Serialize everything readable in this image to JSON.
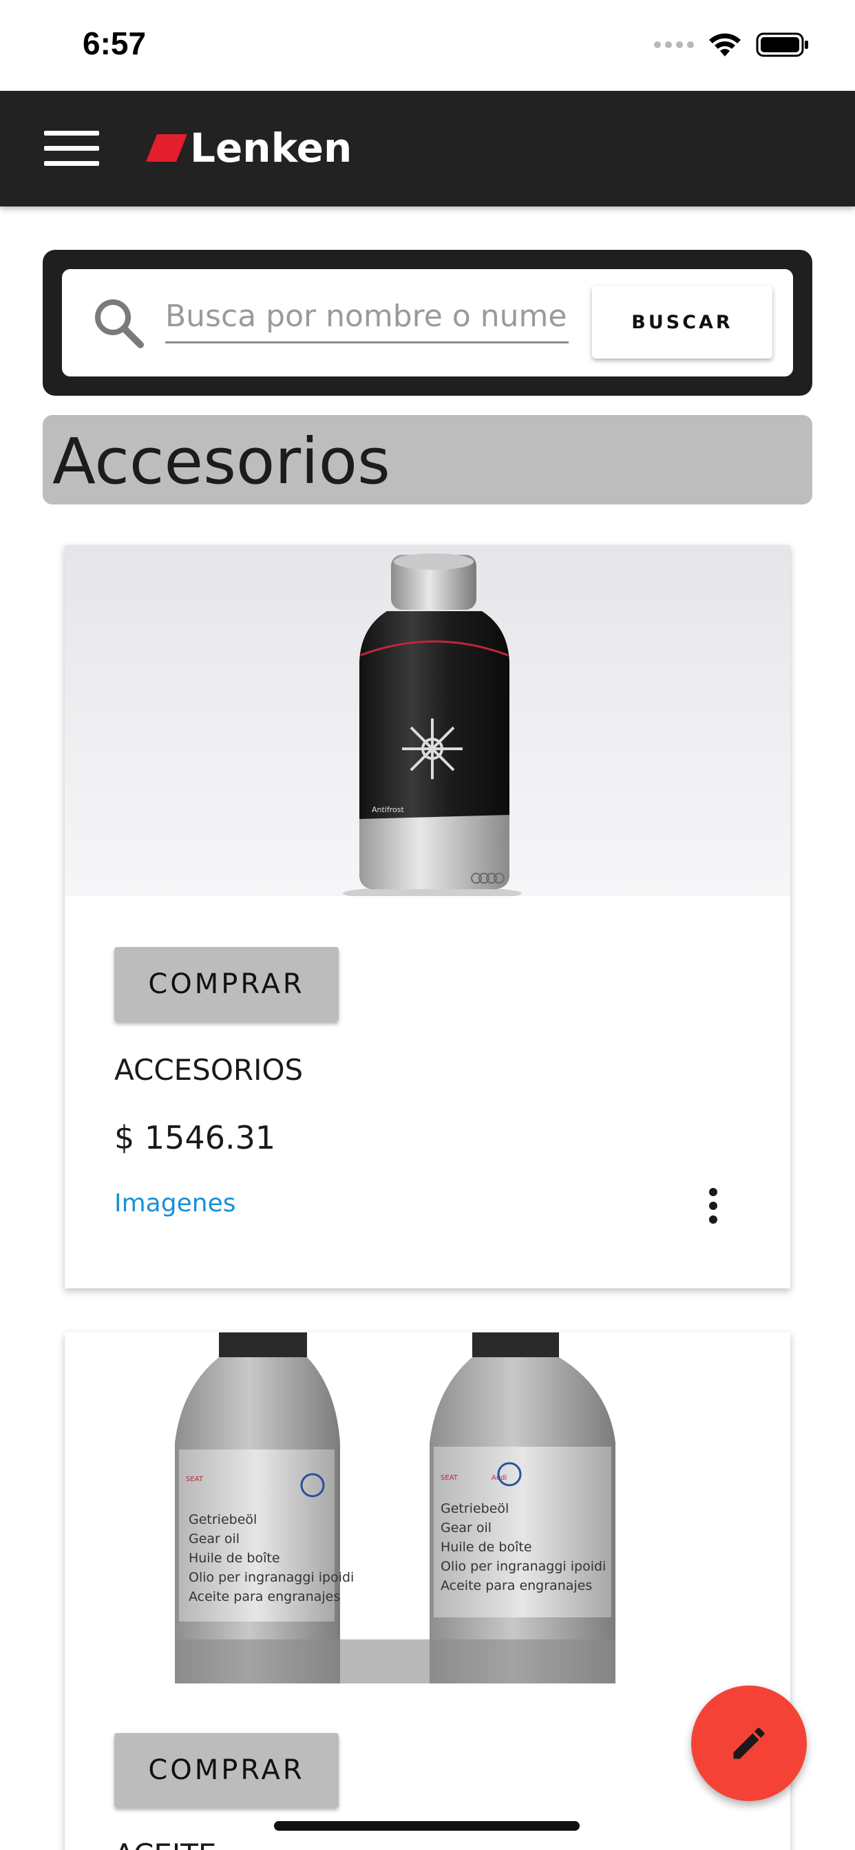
{
  "status_bar": {
    "time": "6:57"
  },
  "app_bar": {
    "logo_text": "Lenken",
    "accent_color": "#e31e2d",
    "icons": [
      "menu-icon"
    ]
  },
  "search": {
    "placeholder": "Busca por nombre o numero",
    "button_label": "BUSCAR"
  },
  "section": {
    "title": "Accesorios"
  },
  "products": [
    {
      "buy_label": "COMPRAR",
      "name": "ACCESORIOS",
      "price": "$ 1546.31",
      "link_label": "Imagenes",
      "image": "antifrost-bottle"
    },
    {
      "buy_label": "COMPRAR",
      "name": "ACEITE",
      "image": "gear-oil-bottles",
      "image_text": {
        "brands": [
          "SEAT",
          "Audi"
        ],
        "lines": [
          "Getriebeöl",
          "Gear oil",
          "Huile de boîte",
          "Olio per ingranaggi ipoidi",
          "Aceite para engranajes"
        ]
      }
    }
  ],
  "fab": {
    "icon": "edit-icon",
    "color": "#f44336"
  }
}
